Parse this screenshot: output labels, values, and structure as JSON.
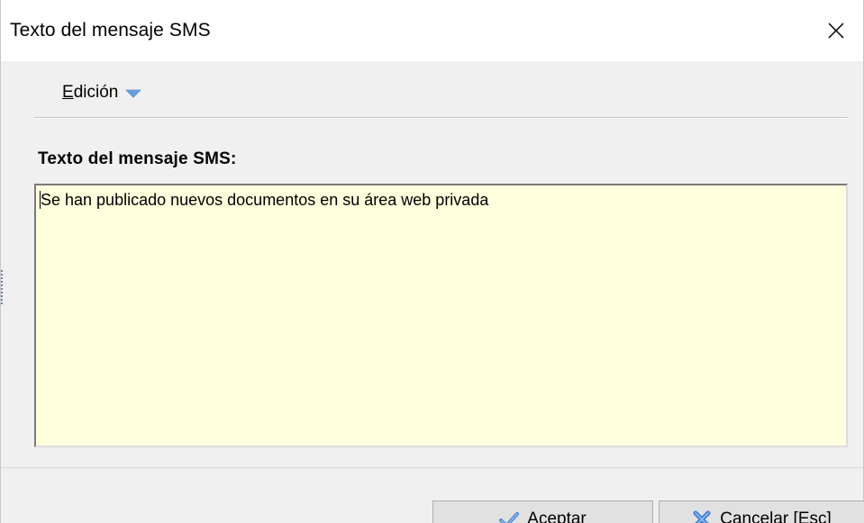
{
  "window": {
    "title": "Texto del mensaje SMS",
    "close_icon": "close-icon"
  },
  "menu": {
    "edicion_first": "E",
    "edicion_rest": "dición",
    "arrow_icon": "chevron-down-icon",
    "arrow_color": "#6a9fe0"
  },
  "form": {
    "label": "Texto del mensaje SMS:",
    "message_value": "Se han publicado nuevos documentos en su área web privada",
    "textarea_bg": "#ffffdd"
  },
  "buttons": {
    "aceptar_first": "A",
    "aceptar_rest": "ceptar",
    "aceptar_icon": "check-icon",
    "cancelar_label": "Cancelar [Esc]",
    "cancelar_icon": "x-icon"
  }
}
